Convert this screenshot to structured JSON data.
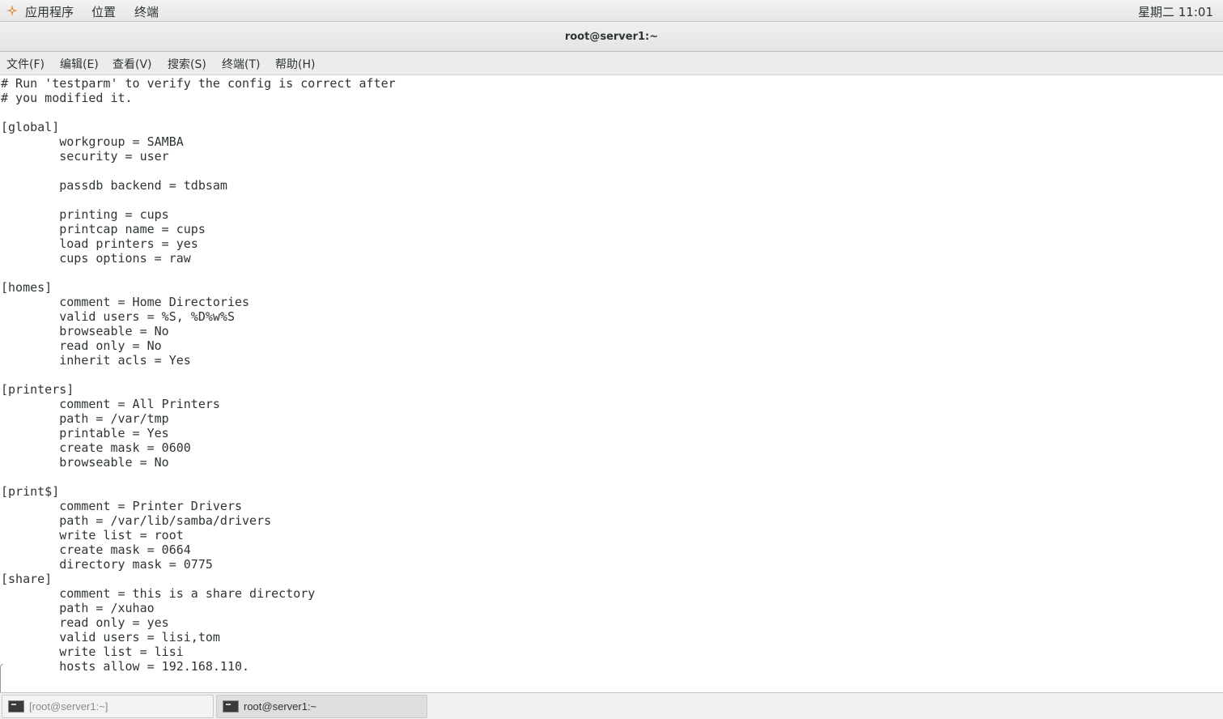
{
  "top_panel": {
    "applications": "应用程序",
    "places": "位置",
    "terminal": "终端",
    "clock": "星期二 11:01"
  },
  "window": {
    "title": "root@server1:~"
  },
  "menu": {
    "file": "文件(F)",
    "edit": "编辑(E)",
    "view": "查看(V)",
    "search": "搜索(S)",
    "terminal": "终端(T)",
    "help": "帮助(H)"
  },
  "terminal": {
    "content": "# Run 'testparm' to verify the config is correct after\n# you modified it.\n\n[global]\n        workgroup = SAMBA\n        security = user\n\n        passdb backend = tdbsam\n\n        printing = cups\n        printcap name = cups\n        load printers = yes\n        cups options = raw\n\n[homes]\n        comment = Home Directories\n        valid users = %S, %D%w%S\n        browseable = No\n        read only = No\n        inherit acls = Yes\n\n[printers]\n        comment = All Printers\n        path = /var/tmp\n        printable = Yes\n        create mask = 0600\n        browseable = No\n\n[print$]\n        comment = Printer Drivers\n        path = /var/lib/samba/drivers\n        write list = root\n        create mask = 0664\n        directory mask = 0775\n[share]\n        comment = this is a share directory\n        path = /xuhao\n        read only = yes\n        valid users = lisi,tom\n        write list = lisi\n        hosts allow = 192.168.110."
  },
  "taskbar": {
    "items": [
      {
        "label": "[root@server1:~]",
        "icon": "terminal-icon",
        "active": false
      },
      {
        "label": "root@server1:~",
        "icon": "terminal-icon",
        "active": true
      }
    ]
  }
}
